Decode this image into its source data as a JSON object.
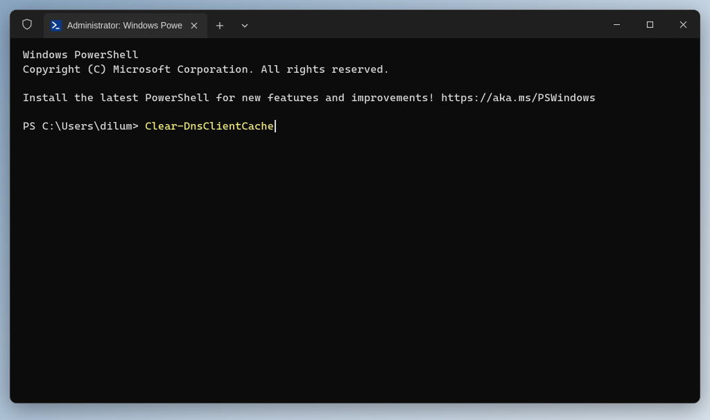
{
  "tab": {
    "title": "Administrator: Windows Powe"
  },
  "terminal": {
    "header_line1": "Windows PowerShell",
    "header_line2": "Copyright (C) Microsoft Corporation. All rights reserved.",
    "install_msg": "Install the latest PowerShell for new features and improvements! https://aka.ms/PSWindows",
    "prompt": "PS C:\\Users\\dilum> ",
    "command": "Clear-DnsClientCache"
  }
}
